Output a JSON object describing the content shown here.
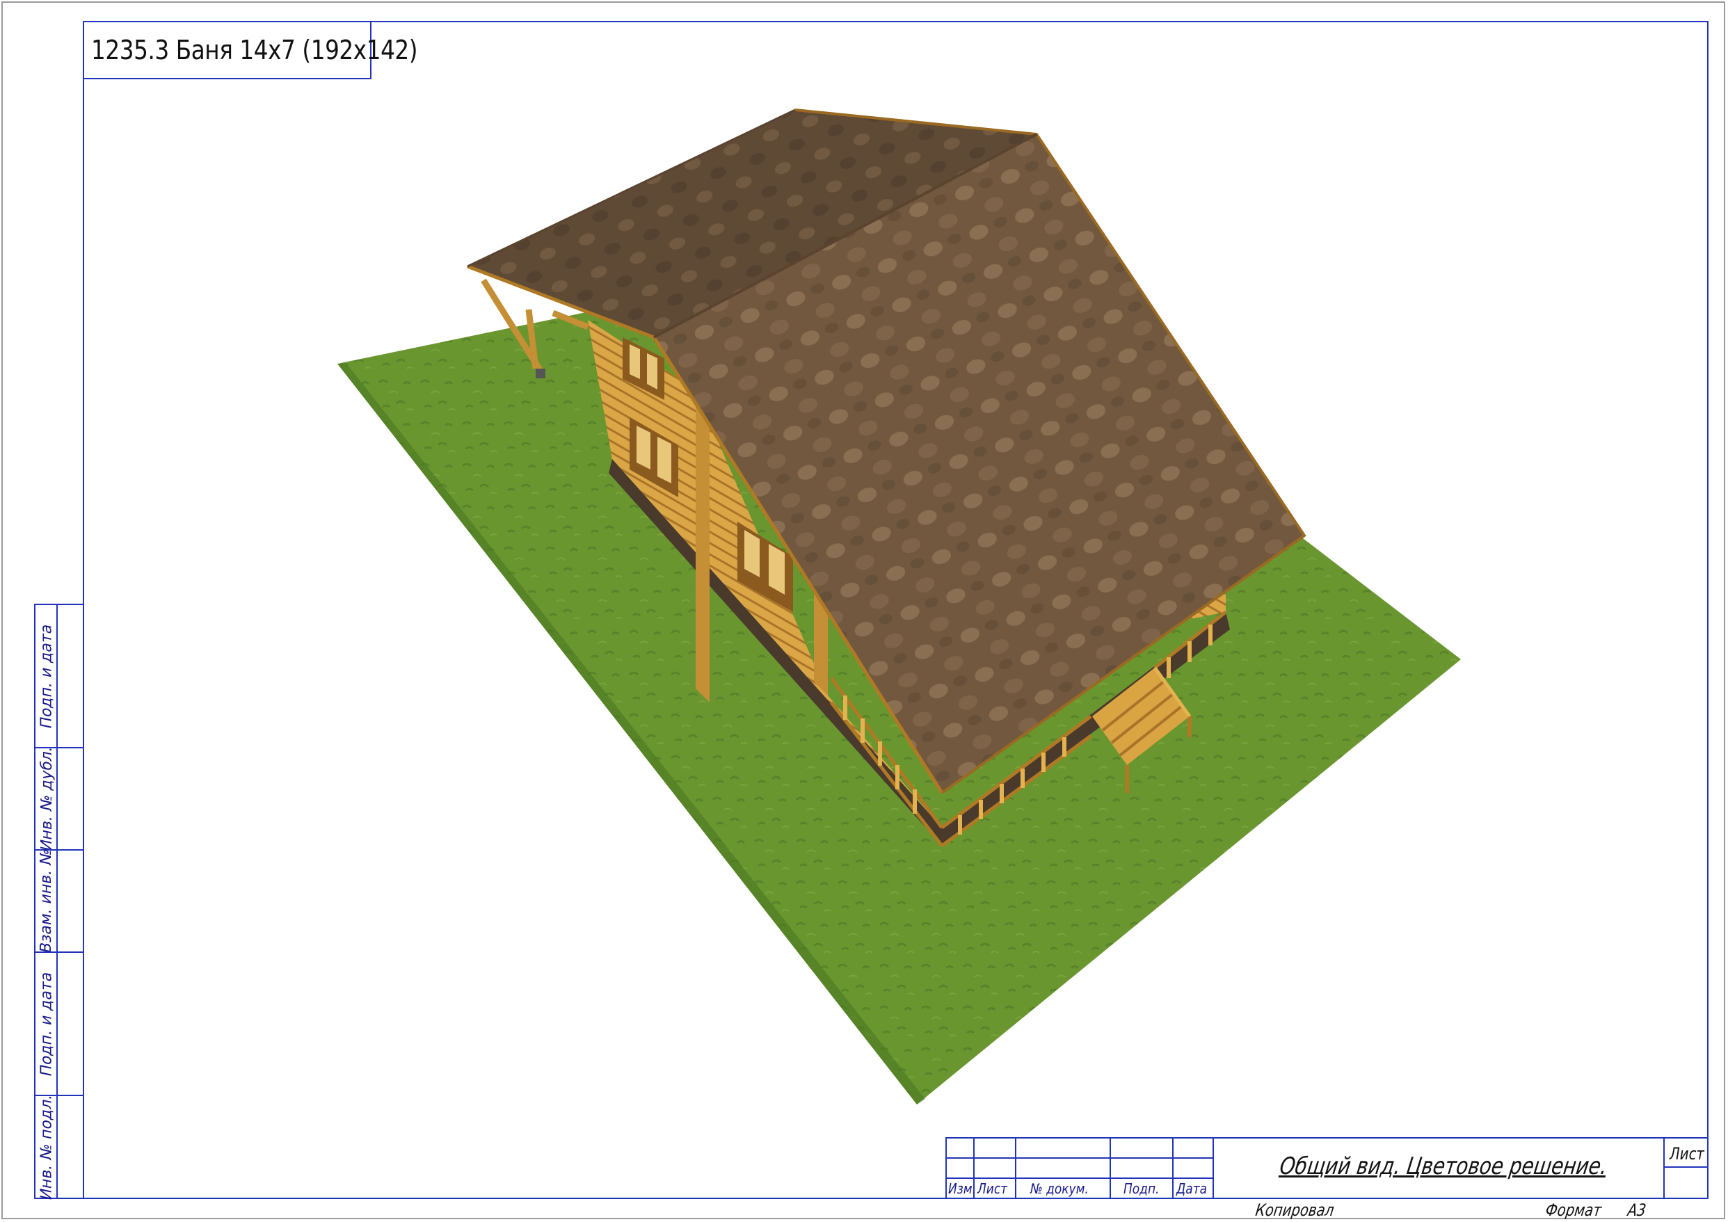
{
  "document": {
    "title": "1235.3 Баня 14х7 (192х142)"
  },
  "drawing": {
    "subject": "house-3d-render",
    "colors": {
      "frame": "#2233bb",
      "grass": "#5f8f2a",
      "grass_dark": "#4b7820",
      "roof": "#6e553f",
      "roof_light": "#866a50",
      "wood": "#d9a441",
      "wood_dark": "#b9832a",
      "foundation": "#4a3a2c"
    }
  },
  "side_strip": {
    "labels": [
      "Подп. и дата",
      "Инв. № дубл.",
      "Взам. инв. №",
      "Подп. и дата",
      "Инв. № подл."
    ]
  },
  "stamp": {
    "headers": [
      "Изм.",
      "Лист",
      "№ докум.",
      "Подп.",
      "Дата"
    ],
    "title": "Общий вид. Цветовое решение.",
    "sheet_label": "Лист"
  },
  "footer": {
    "copied": "Копировал",
    "format_label": "Формат",
    "format_value": "А3"
  }
}
